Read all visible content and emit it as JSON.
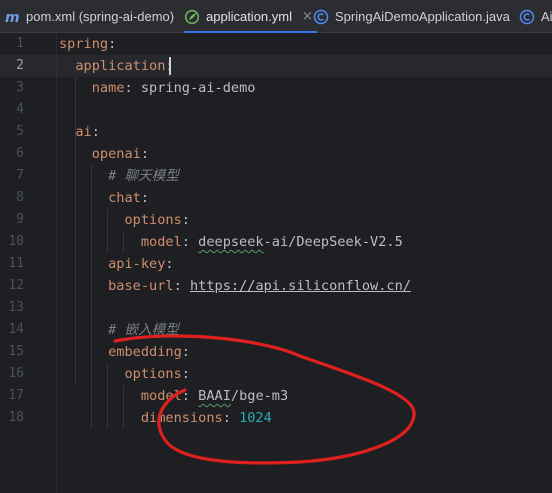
{
  "tabs": [
    {
      "label": "pom.xml (spring-ai-demo)",
      "icon": "maven-icon",
      "active": false
    },
    {
      "label": "application.yml",
      "icon": "spring-leaf-icon",
      "active": true,
      "close": "×"
    },
    {
      "label": "SpringAiDemoApplication.java",
      "icon": "java-class-icon",
      "active": false
    },
    {
      "label": "Ai",
      "icon": "java-class-icon",
      "active": false
    }
  ],
  "editor": {
    "current_line": 2,
    "line_numbers": [
      "1",
      "2",
      "3",
      "4",
      "5",
      "6",
      "7",
      "8",
      "9",
      "10",
      "11",
      "12",
      "13",
      "14",
      "15",
      "16",
      "17",
      "18"
    ],
    "lines": {
      "l1": {
        "key": "spring",
        "colon": ":"
      },
      "l2": {
        "key": "application",
        "colon": ":"
      },
      "l3": {
        "key": "name",
        "colon": ":",
        "value": " spring-ai-demo"
      },
      "l5": {
        "key": "ai",
        "colon": ":"
      },
      "l6": {
        "key": "openai",
        "colon": ":"
      },
      "l7": {
        "comment": "# 聊天模型"
      },
      "l8": {
        "key": "chat",
        "colon": ":"
      },
      "l9": {
        "key": "options",
        "colon": ":"
      },
      "l10": {
        "key": "model",
        "colon": ":",
        "value_a": "deepseek",
        "value_b": "-ai/DeepSeek-V2.5"
      },
      "l11": {
        "key": "api-key",
        "colon": ":"
      },
      "l12": {
        "key": "base-url",
        "colon": ":",
        "value": "https://api.siliconflow.cn/"
      },
      "l14": {
        "comment": "# 嵌入模型"
      },
      "l15": {
        "key": "embedding",
        "colon": ":"
      },
      "l16": {
        "key": "options",
        "colon": ":"
      },
      "l17": {
        "key": "model",
        "colon": ":",
        "value_a": "BAAI",
        "value_b": "/bge-m3"
      },
      "l18": {
        "key": "dimensions",
        "colon": ":",
        "value": "1024"
      }
    }
  },
  "colors": {
    "key": "#cf8e6d",
    "number": "#2aacb8",
    "comment": "#7a7e85",
    "annotation": "#e0201f",
    "tab_active_underline": "#3574f0"
  }
}
